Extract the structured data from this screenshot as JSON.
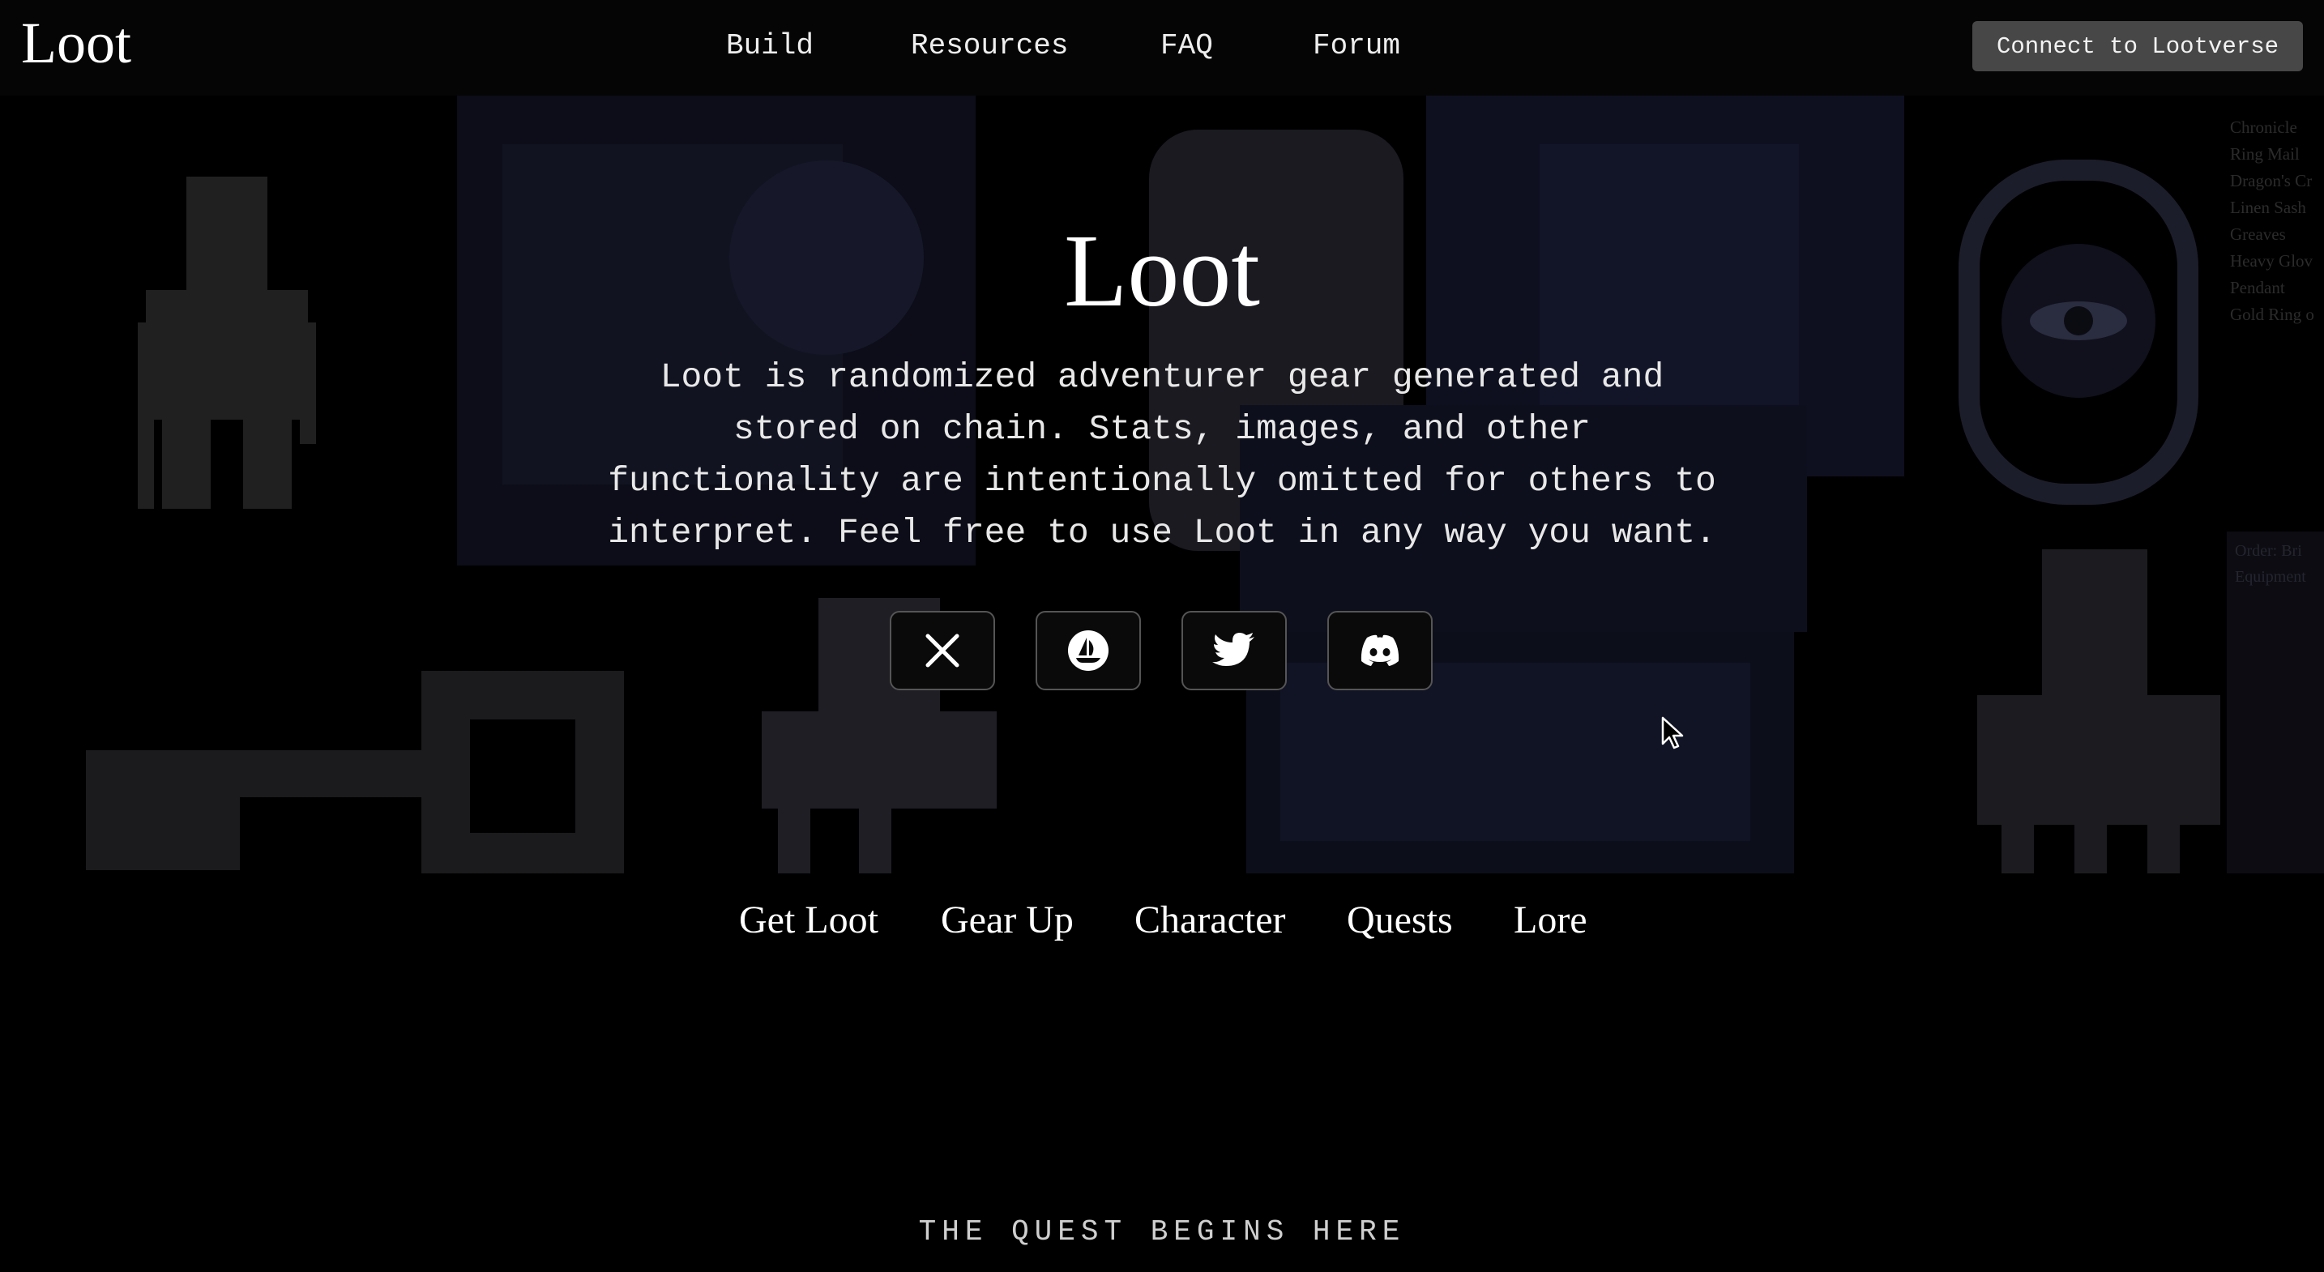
{
  "header": {
    "logo": "Loot",
    "nav": [
      "Build",
      "Resources",
      "FAQ",
      "Forum"
    ],
    "connect_label": "Connect to Lootverse"
  },
  "hero": {
    "title": "Loot",
    "description": "Loot is randomized adventurer gear generated and stored on chain. Stats, images, and other functionality are intentionally omitted for others to interpret. Feel free to use Loot in any way you want."
  },
  "socials": [
    "x-icon",
    "opensea-icon",
    "twitter-icon",
    "discord-icon"
  ],
  "tabs": [
    "Get Loot",
    "Gear Up",
    "Character",
    "Quests",
    "Lore"
  ],
  "footer": {
    "tagline": "THE QUEST BEGINS HERE"
  },
  "background_items": [
    "Chronicle",
    "Ring Mail",
    "Dragon's Cr",
    "Linen Sash",
    "Greaves",
    "Heavy Glov",
    "Pendant",
    "Gold Ring o"
  ],
  "background_card": [
    "Order: Bri",
    "Equipment"
  ],
  "colors": {
    "background": "#000000",
    "header": "#050505",
    "button": "#474747",
    "text": "#ffffff"
  }
}
